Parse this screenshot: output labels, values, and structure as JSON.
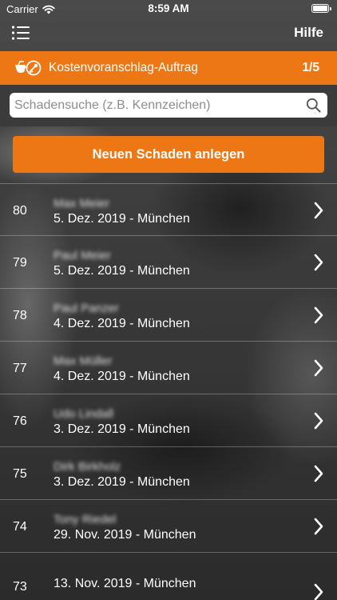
{
  "status_bar": {
    "carrier": "Carrier",
    "time": "8:59 AM"
  },
  "nav": {
    "help_label": "Hilfe",
    "menu_icon": "list-menu-icon"
  },
  "header": {
    "title": "Kostenvoranschlag-Auftrag",
    "page_indicator": "1/5",
    "icon": "glasses-key-icon",
    "accent_color": "#ee7715"
  },
  "search": {
    "placeholder": "Schadensuche (z.B. Kennzeichen)",
    "value": ""
  },
  "new_damage_button": {
    "label": "Neuen Schaden anlegen"
  },
  "damages": [
    {
      "number": "80",
      "name": "Max Meier",
      "detail": "5. Dez. 2019 - München"
    },
    {
      "number": "79",
      "name": "Paul Meier",
      "detail": "5. Dez. 2019 - München"
    },
    {
      "number": "78",
      "name": "Paul Panzer",
      "detail": "4. Dez. 2019 - München"
    },
    {
      "number": "77",
      "name": "Max Müller",
      "detail": "4. Dez. 2019 - München"
    },
    {
      "number": "76",
      "name": "Udo Lindall",
      "detail": "3. Dez. 2019 - München"
    },
    {
      "number": "75",
      "name": "Dirk Birkholz",
      "detail": "3. Dez. 2019 - München"
    },
    {
      "number": "74",
      "name": "Tony Riedel",
      "detail": "29. Nov. 2019 - München"
    },
    {
      "number": "73",
      "name": "",
      "detail": "13. Nov. 2019 - München"
    }
  ]
}
